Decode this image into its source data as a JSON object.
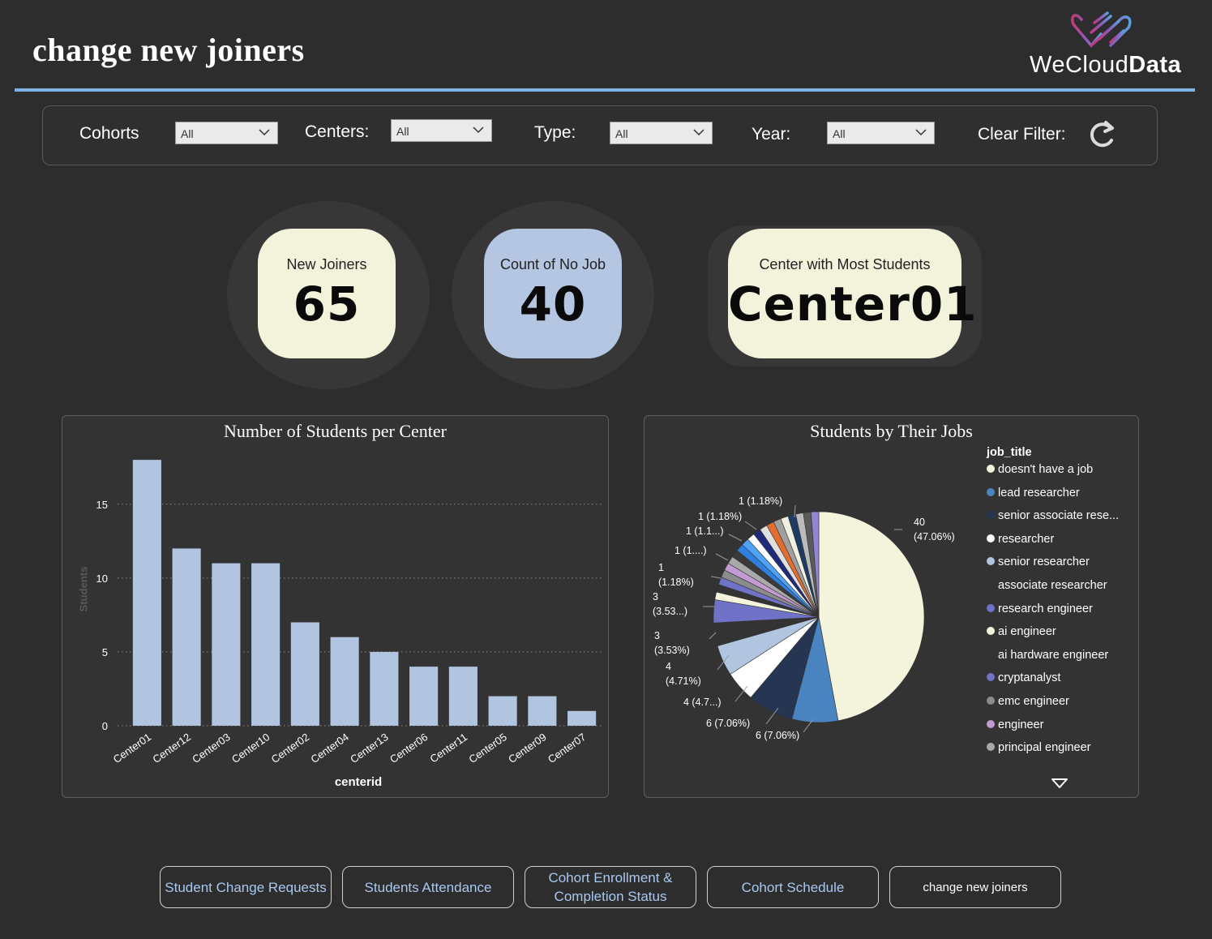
{
  "header": {
    "title": "change new joiners",
    "logo_text_light": "WeCloud",
    "logo_text_bold": "Data"
  },
  "filters": {
    "cohorts_label": "Cohorts",
    "cohorts_value": "All",
    "centers_label": "Centers:",
    "centers_value": "All",
    "type_label": "Type:",
    "type_value": "All",
    "year_label": "Year:",
    "year_value": "All",
    "clear_label": "Clear Filter:"
  },
  "kpis": {
    "new_joiners": {
      "label": "New Joiners",
      "value": "65",
      "color": "#f3f3dc"
    },
    "no_job": {
      "label": "Count of No Job",
      "value": "40",
      "color": "#b4c6e1"
    },
    "top_center": {
      "label": "Center with Most Students",
      "value": "Center01",
      "color": "#f3f3dc"
    }
  },
  "bar_chart": {
    "title": "Number of Students per Center",
    "xlabel": "centerid",
    "ylabel": "Students"
  },
  "pie_chart": {
    "title": "Students by Their Jobs",
    "legend_title": "job_title"
  },
  "chart_data": [
    {
      "type": "bar",
      "title": "Number of Students per Center",
      "xlabel": "centerid",
      "ylabel": "Students",
      "categories": [
        "Center01",
        "Center12",
        "Center03",
        "Center10",
        "Center02",
        "Center04",
        "Center13",
        "Center06",
        "Center11",
        "Center05",
        "Center09",
        "Center07"
      ],
      "values": [
        18,
        12,
        11,
        11,
        7,
        6,
        5,
        4,
        4,
        2,
        2,
        1
      ],
      "yticks": [
        0,
        5,
        10,
        15
      ],
      "ylim": [
        0,
        18.5
      ],
      "grid": true,
      "color": "#b1c4e0"
    },
    {
      "type": "pie",
      "title": "Students by Their Jobs",
      "legend_title": "job_title",
      "legend": [
        {
          "label": "doesn't have a job",
          "color": "#f4f4dc"
        },
        {
          "label": "lead researcher",
          "color": "#4a84c0"
        },
        {
          "label": "senior associate rese...",
          "color": "#253552"
        },
        {
          "label": "researcher",
          "color": "#ffffff"
        },
        {
          "label": "senior researcher",
          "color": "#b1c4e0"
        },
        {
          "label": "associate researcher",
          "color": "#333333"
        },
        {
          "label": "research engineer",
          "color": "#6f72c6"
        },
        {
          "label": "ai engineer",
          "color": "#f4f4dc"
        },
        {
          "label": "ai hardware engineer",
          "color": "#333333"
        },
        {
          "label": "cryptanalyst",
          "color": "#6f72c6"
        },
        {
          "label": "emc engineer",
          "color": "#8c8c8c"
        },
        {
          "label": "engineer",
          "color": "#c39bd3"
        },
        {
          "label": "principal engineer",
          "color": "#a9a9a9"
        }
      ],
      "slices": [
        {
          "value": 40,
          "color": "#f4f4dc"
        },
        {
          "value": 6,
          "color": "#4a84c0"
        },
        {
          "value": 6,
          "color": "#253552"
        },
        {
          "value": 4,
          "color": "#ffffff"
        },
        {
          "value": 4,
          "color": "#b1c4e0"
        },
        {
          "value": 3,
          "color": "#333333"
        },
        {
          "value": 3,
          "color": "#6f72c6"
        },
        {
          "value": 1,
          "color": "#f4f4dc"
        },
        {
          "value": 1,
          "color": "#333333"
        },
        {
          "value": 1,
          "color": "#6f72c6"
        },
        {
          "value": 1,
          "color": "#8c8c8c"
        },
        {
          "value": 1,
          "color": "#c39bd3"
        },
        {
          "value": 1,
          "color": "#a9a9a9"
        },
        {
          "value": 1,
          "color": "#3a3a3a"
        },
        {
          "value": 1,
          "color": "#2f7fe0"
        },
        {
          "value": 1,
          "color": "#4fa3f7"
        },
        {
          "value": 1,
          "color": "#ffffff"
        },
        {
          "value": 1,
          "color": "#1f2a7a"
        },
        {
          "value": 1,
          "color": "#e0e0e0"
        },
        {
          "value": 1,
          "color": "#e36c2f"
        },
        {
          "value": 1,
          "color": "#a0a0a0"
        },
        {
          "value": 1,
          "color": "#f0f0e0"
        },
        {
          "value": 1,
          "color": "#1e3b66"
        },
        {
          "value": 1,
          "color": "#bbbbbb"
        },
        {
          "value": 1,
          "color": "#5a5a5a"
        },
        {
          "value": 1,
          "color": "#8f86d8"
        }
      ],
      "data_labels": [
        {
          "line1": "40",
          "line2": "(47.06%)"
        },
        {
          "line1": "6 (7.06%)",
          "line2": ""
        },
        {
          "line1": "6 (7.06%)",
          "line2": ""
        },
        {
          "line1": "4 (4.7...)",
          "line2": ""
        },
        {
          "line1": "4",
          "line2": "(4.71%)"
        },
        {
          "line1": "3",
          "line2": "(3.53%)"
        },
        {
          "line1": "3",
          "line2": "(3.53...)"
        },
        {
          "line1": "1",
          "line2": "(1.18%)"
        },
        {
          "line1": "1 (1....)",
          "line2": ""
        },
        {
          "line1": "1 (1.1...)",
          "line2": ""
        },
        {
          "line1": "1 (1.18%)",
          "line2": ""
        },
        {
          "line1": "1 (1.18%)",
          "line2": ""
        }
      ]
    }
  ],
  "nav": {
    "student_change_requests": "Student Change Requests",
    "students_attendance": "Students Attendance",
    "cohort_enrollment_l1": "Cohort Enrollment &",
    "cohort_enrollment_l2": "Completion Status",
    "cohort_schedule": "Cohort Schedule",
    "change_new_joiners": "change new joiners"
  }
}
